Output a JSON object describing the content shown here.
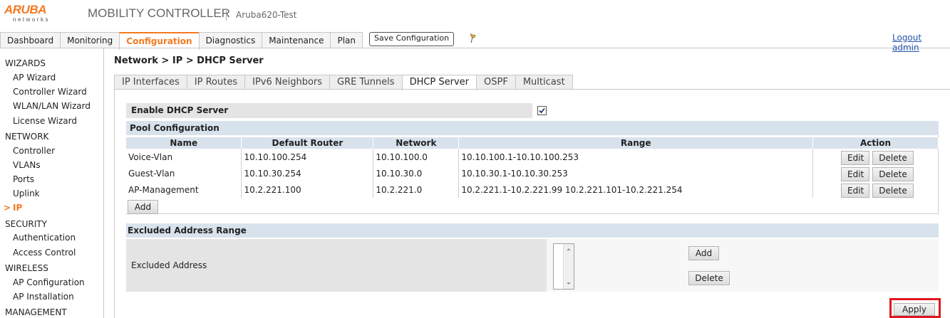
{
  "header": {
    "logo_top": "ARUBA",
    "logo_bottom": "networks",
    "product": "MOBILITY CONTROLLER",
    "controller_name": "Aruba620-Test",
    "save_label": "Save Configuration",
    "logout_label": "Logout admin"
  },
  "main_tabs": [
    {
      "label": "Dashboard"
    },
    {
      "label": "Monitoring"
    },
    {
      "label": "Configuration"
    },
    {
      "label": "Diagnostics"
    },
    {
      "label": "Maintenance"
    },
    {
      "label": "Plan"
    }
  ],
  "sidebar": {
    "wizards": "WIZARDS",
    "wizard_items": [
      "AP Wizard",
      "Controller Wizard",
      "WLAN/LAN Wizard",
      "License Wizard"
    ],
    "network": "NETWORK",
    "network_items": [
      "Controller",
      "VLANs",
      "Ports",
      "Uplink",
      "IP"
    ],
    "current_marker": ">",
    "security": "SECURITY",
    "security_items": [
      "Authentication",
      "Access Control"
    ],
    "wireless": "WIRELESS",
    "wireless_items": [
      "AP Configuration",
      "AP Installation"
    ],
    "management": "MANAGEMENT"
  },
  "breadcrumb": "Network > IP > DHCP Server",
  "sub_tabs": [
    {
      "label": "IP Interfaces"
    },
    {
      "label": "IP Routes"
    },
    {
      "label": "IPv6 Neighbors"
    },
    {
      "label": "GRE Tunnels"
    },
    {
      "label": "DHCP Server"
    },
    {
      "label": "OSPF"
    },
    {
      "label": "Multicast"
    }
  ],
  "dhcp": {
    "enable_label": "Enable DHCP Server",
    "enable_checked": true,
    "pool_title": "Pool Configuration",
    "columns": [
      "Name",
      "Default Router",
      "Network",
      "Range",
      "Action"
    ],
    "rows": [
      {
        "name": "Voice-Vlan",
        "router": "10.10.100.254",
        "network": "10.10.100.0",
        "range": "10.10.100.1-10.10.100.253"
      },
      {
        "name": "Guest-Vlan",
        "router": "10.10.30.254",
        "network": "10.10.30.0",
        "range": "10.10.30.1-10.10.30.253"
      },
      {
        "name": "AP-Management",
        "router": "10.2.221.100",
        "network": "10.2.221.0",
        "range": "10.2.221.1-10.2.221.99 10.2.221.101-10.2.221.254"
      }
    ],
    "edit_label": "Edit",
    "delete_label": "Delete",
    "add_label": "Add",
    "excluded_title": "Excluded Address Range",
    "excluded_label": "Excluded Address",
    "excl_add_label": "Add",
    "excl_delete_label": "Delete",
    "apply_label": "Apply"
  },
  "colors": {
    "accent": "#f47920",
    "highlight": "#e0161e",
    "section_bg": "#d8e2ec"
  }
}
